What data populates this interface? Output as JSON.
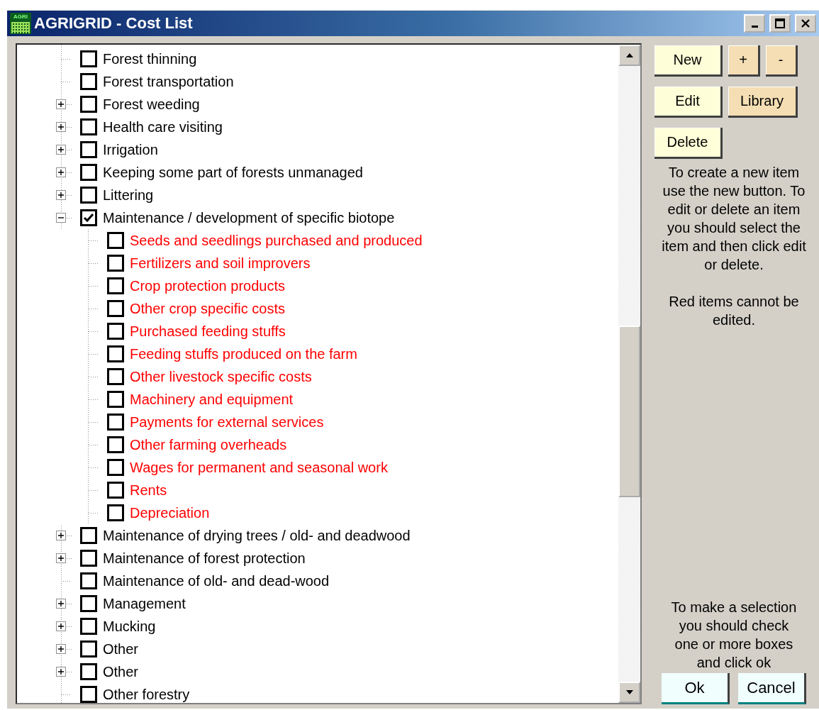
{
  "window": {
    "icon_text": "AGRI",
    "title": "AGRIGRID - Cost List"
  },
  "tree": {
    "items": [
      {
        "label": "Forest thinning",
        "kind": "leaf",
        "checked": false,
        "editable": true
      },
      {
        "label": "Forest transportation",
        "kind": "leaf",
        "checked": false,
        "editable": true
      },
      {
        "label": "Forest weeding",
        "kind": "group",
        "expanded": false,
        "checked": false,
        "editable": true
      },
      {
        "label": "Health care visiting",
        "kind": "group",
        "expanded": false,
        "checked": false,
        "editable": true
      },
      {
        "label": "Irrigation",
        "kind": "group",
        "expanded": false,
        "checked": false,
        "editable": true
      },
      {
        "label": "Keeping some part of forests unmanaged",
        "kind": "group",
        "expanded": false,
        "checked": false,
        "editable": true
      },
      {
        "label": "Littering",
        "kind": "group",
        "expanded": false,
        "checked": false,
        "editable": true
      },
      {
        "label": "Maintenance / development of specific biotope",
        "kind": "group",
        "expanded": true,
        "checked": true,
        "editable": true,
        "children": [
          {
            "label": "Seeds and seedlings purchased and produced",
            "checked": false,
            "editable": false
          },
          {
            "label": "Fertilizers and soil improvers",
            "checked": false,
            "editable": false
          },
          {
            "label": "Crop protection products",
            "checked": false,
            "editable": false
          },
          {
            "label": "Other crop specific costs",
            "checked": false,
            "editable": false
          },
          {
            "label": "Purchased feeding stuffs",
            "checked": false,
            "editable": false
          },
          {
            "label": "Feeding stuffs produced on the farm",
            "checked": false,
            "editable": false
          },
          {
            "label": "Other livestock specific costs",
            "checked": false,
            "editable": false
          },
          {
            "label": "Machinery and equipment",
            "checked": false,
            "editable": false
          },
          {
            "label": "Payments for external services",
            "checked": false,
            "editable": false
          },
          {
            "label": "Other farming overheads",
            "checked": false,
            "editable": false
          },
          {
            "label": "Wages for permanent and seasonal work",
            "checked": false,
            "editable": false
          },
          {
            "label": "Rents",
            "checked": false,
            "editable": false
          },
          {
            "label": "Depreciation",
            "checked": false,
            "editable": false
          }
        ]
      },
      {
        "label": "Maintenance of drying trees / old- and deadwood",
        "kind": "group",
        "expanded": false,
        "checked": false,
        "editable": true
      },
      {
        "label": "Maintenance of forest protection",
        "kind": "group",
        "expanded": false,
        "checked": false,
        "editable": true
      },
      {
        "label": "Maintenance of old- and dead-wood",
        "kind": "leaf",
        "checked": false,
        "editable": true
      },
      {
        "label": "Management",
        "kind": "group",
        "expanded": false,
        "checked": false,
        "editable": true
      },
      {
        "label": "Mucking",
        "kind": "group",
        "expanded": false,
        "checked": false,
        "editable": true
      },
      {
        "label": "Other",
        "kind": "group",
        "expanded": false,
        "checked": false,
        "editable": true
      },
      {
        "label": "Other",
        "kind": "group",
        "expanded": false,
        "checked": false,
        "editable": true
      },
      {
        "label": "Other forestry",
        "kind": "leaf",
        "checked": false,
        "editable": true
      }
    ]
  },
  "buttons": [
    {
      "label": "New",
      "kind": "main"
    },
    {
      "label": "+",
      "kind": "small"
    },
    {
      "label": "-",
      "kind": "small"
    },
    {
      "label": "Edit",
      "kind": "main"
    },
    {
      "label": "Library",
      "kind": "wide"
    },
    {
      "label": "Delete",
      "kind": "main"
    }
  ],
  "help_texts": [
    "To create a new item use the new button. To edit or delete an item you should select the item and then click edit or delete.",
    "Red items cannot be edited."
  ],
  "selection_hint": "To make a selection you should check one or more boxes and click ok",
  "dialog_buttons": [
    "Ok",
    "Cancel"
  ]
}
